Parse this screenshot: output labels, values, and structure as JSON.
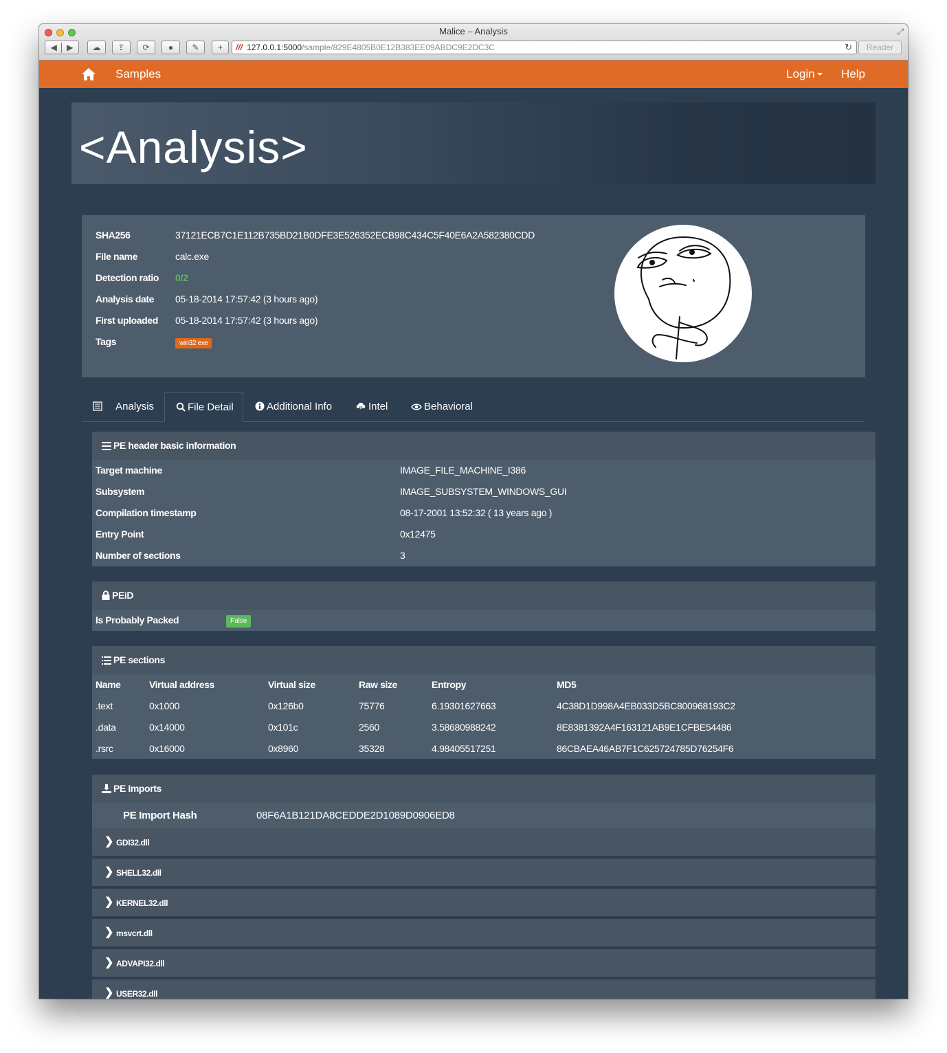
{
  "window": {
    "title": "Malice – Analysis",
    "url_host": "127.0.0.1:5000",
    "url_path": "/sample/829E4805B0E12B383EE09ABDC9E2DC3C",
    "reader_label": "Reader"
  },
  "navbar": {
    "samples": "Samples",
    "login": "Login",
    "help": "Help"
  },
  "page": {
    "heading": "<Analysis>"
  },
  "summary": {
    "sha256_label": "SHA256",
    "sha256": "37121ECB7C1E112B735BD21B0DFE3E526352ECB98C434C5F40E6A2A582380CDD",
    "filename_label": "File name",
    "filename": "calc.exe",
    "ratio_label": "Detection ratio",
    "ratio": "0/2",
    "analysis_date_label": "Analysis date",
    "analysis_date": "05-18-2014 17:57:42 (3 hours ago)",
    "first_uploaded_label": "First uploaded",
    "first_uploaded": "05-18-2014 17:57:42 (3 hours ago)",
    "tags_label": "Tags",
    "tag": "win32 exe"
  },
  "tabs": [
    {
      "label": "Analysis",
      "icon": "list-icon"
    },
    {
      "label": "File Detail",
      "icon": "zoom-icon"
    },
    {
      "label": "Additional Info",
      "icon": "info-icon"
    },
    {
      "label": "Intel",
      "icon": "cloud-download-icon"
    },
    {
      "label": "Behavioral",
      "icon": "eye-icon"
    }
  ],
  "pe_header": {
    "title": "PE header basic information",
    "rows": [
      {
        "key": "Target machine",
        "value": "IMAGE_FILE_MACHINE_I386"
      },
      {
        "key": "Subsystem",
        "value": "IMAGE_SUBSYSTEM_WINDOWS_GUI"
      },
      {
        "key": "Compilation timestamp",
        "value": "08-17-2001 13:52:32 ( 13 years ago )"
      },
      {
        "key": "Entry Point",
        "value": "0x12475"
      },
      {
        "key": "Number of sections",
        "value": "3"
      }
    ]
  },
  "peid": {
    "title": "PEiD",
    "packed_label": "Is Probably Packed",
    "packed_value": "False"
  },
  "pe_sections": {
    "title": "PE sections",
    "columns": [
      "Name",
      "Virtual address",
      "Virtual size",
      "Raw size",
      "Entropy",
      "MD5"
    ],
    "rows": [
      [
        ".text",
        "0x1000",
        "0x126b0",
        "75776",
        "6.19301627663",
        "4C38D1D998A4EB033D5BC800968193C2"
      ],
      [
        ".data",
        "0x14000",
        "0x101c",
        "2560",
        "3.58680988242",
        "8E8381392A4F163121AB9E1CFBE54486"
      ],
      [
        ".rsrc",
        "0x16000",
        "0x8960",
        "35328",
        "4.98405517251",
        "86CBAEA46AB7F1C625724785D76254F6"
      ]
    ]
  },
  "pe_imports": {
    "title": "PE Imports",
    "hash_label": "PE Import Hash",
    "hash": "08F6A1B121DA8CEDDE2D1089D0906ED8",
    "dlls": [
      "GDI32.dll",
      "SHELL32.dll",
      "KERNEL32.dll",
      "msvcrt.dll",
      "ADVAPI32.dll",
      "USER32.dll"
    ]
  },
  "colors": {
    "accent": "#df691a",
    "background": "#2c3e50",
    "panel": "#4e5d6c",
    "success": "#5cb85c"
  }
}
